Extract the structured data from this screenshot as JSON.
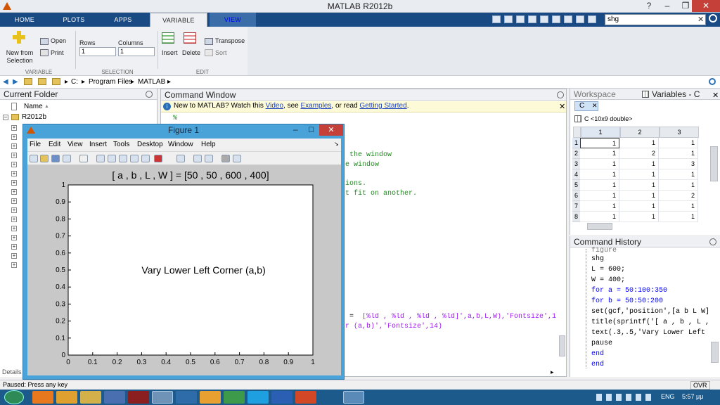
{
  "window": {
    "title": "MATLAB R2012b"
  },
  "ribbon_tabs": [
    {
      "label": "HOME"
    },
    {
      "label": "PLOTS"
    },
    {
      "label": "APPS"
    },
    {
      "label": "VARIABLE"
    },
    {
      "label": "VIEW"
    }
  ],
  "search": {
    "value": "shg"
  },
  "ribbon": {
    "new_from_selection": "New from\nSelection",
    "open": "Open",
    "print": "Print",
    "rows_label": "Rows",
    "rows_value": "1",
    "columns_label": "Columns",
    "columns_value": "1",
    "insert": "Insert",
    "delete": "Delete",
    "transpose": "Transpose",
    "sort": "Sort",
    "group_variable": "VARIABLE",
    "group_selection": "SELECTION",
    "group_edit": "EDIT"
  },
  "address": {
    "parts": [
      "C:",
      "Program Files",
      "MATLAB"
    ]
  },
  "current_folder": {
    "title": "Current Folder",
    "name_col": "Name",
    "root": "R2012b",
    "details": "Details"
  },
  "command_window": {
    "title": "Command Window",
    "info_prefix": "New to MATLAB? Watch this ",
    "info_link1": "Video",
    "info_mid1": ", see ",
    "info_link2": "Examples",
    "info_mid2": ", or read ",
    "info_link3": "Getting Started",
    "info_end": ".",
    "line_pct": "%",
    "line1": " the window",
    "line2": "e window",
    "line3": "ions.",
    "line4": "t fit on another.",
    "line5a": " = ",
    "line5b": " [%ld , %ld , %ld , %ld]',a,b,L,W),'Fontsize',1",
    "line6": "r (a,b)','Fontsize',14)"
  },
  "workspace": {
    "tab_workspace": "Workspace",
    "tab_variables": "Variables - C",
    "var_tab": "C",
    "var_desc": "C <10x9 double>",
    "col_headers": [
      "1",
      "2",
      "3"
    ],
    "row_headers": [
      "1",
      "2",
      "3",
      "4",
      "5",
      "6",
      "7",
      "8"
    ],
    "cells": [
      [
        "1",
        "1",
        "1"
      ],
      [
        "1",
        "2",
        "1"
      ],
      [
        "1",
        "1",
        "3"
      ],
      [
        "1",
        "1",
        "1"
      ],
      [
        "1",
        "1",
        "1"
      ],
      [
        "1",
        "1",
        "2"
      ],
      [
        "1",
        "1",
        "1"
      ],
      [
        "1",
        "1",
        "1"
      ]
    ]
  },
  "history": {
    "title": "Command History",
    "lines": [
      "figure",
      "shg",
      "L = 600;",
      "W = 400;",
      "for a = 50:100:350",
      "for b = 50:50:200",
      "set(gcf,'position',[a b L W]",
      "title(sprintf('[ a , b , L ,",
      "text(.3,.5,'Vary Lower Left",
      "pause",
      "end",
      "end"
    ]
  },
  "figure": {
    "title": "Figure 1",
    "menu": [
      "File",
      "Edit",
      "View",
      "Insert",
      "Tools",
      "Desktop",
      "Window",
      "Help"
    ],
    "plot_title": "[ a , b , L , W ] = [50 , 50 , 600 , 400]",
    "plot_text": "Vary Lower Left Corner (a,b)"
  },
  "chart_data": {
    "type": "line",
    "title": "[ a , b , L , W ] = [50 , 50 , 600 , 400]",
    "xlabel": "",
    "ylabel": "",
    "xlim": [
      0,
      1
    ],
    "ylim": [
      0,
      1
    ],
    "xticks": [
      "0",
      "0.1",
      "0.2",
      "0.3",
      "0.4",
      "0.5",
      "0.6",
      "0.7",
      "0.8",
      "0.9",
      "1"
    ],
    "yticks": [
      "0",
      "0.1",
      "0.2",
      "0.3",
      "0.4",
      "0.5",
      "0.6",
      "0.7",
      "0.8",
      "0.9",
      "1"
    ],
    "grid": false,
    "annotations": [
      {
        "text": "Vary Lower Left Corner (a,b)",
        "x": 0.3,
        "y": 0.5
      }
    ],
    "series": []
  },
  "status": {
    "text": "Paused: Press any key",
    "mode": "OVR"
  },
  "taskbar": {
    "lang": "ENG",
    "time": "5:57 μμ"
  },
  "colors": {
    "tab_bar": "#1a4a83",
    "figure_border": "#4aa3d8",
    "close_button": "#c6403a"
  }
}
